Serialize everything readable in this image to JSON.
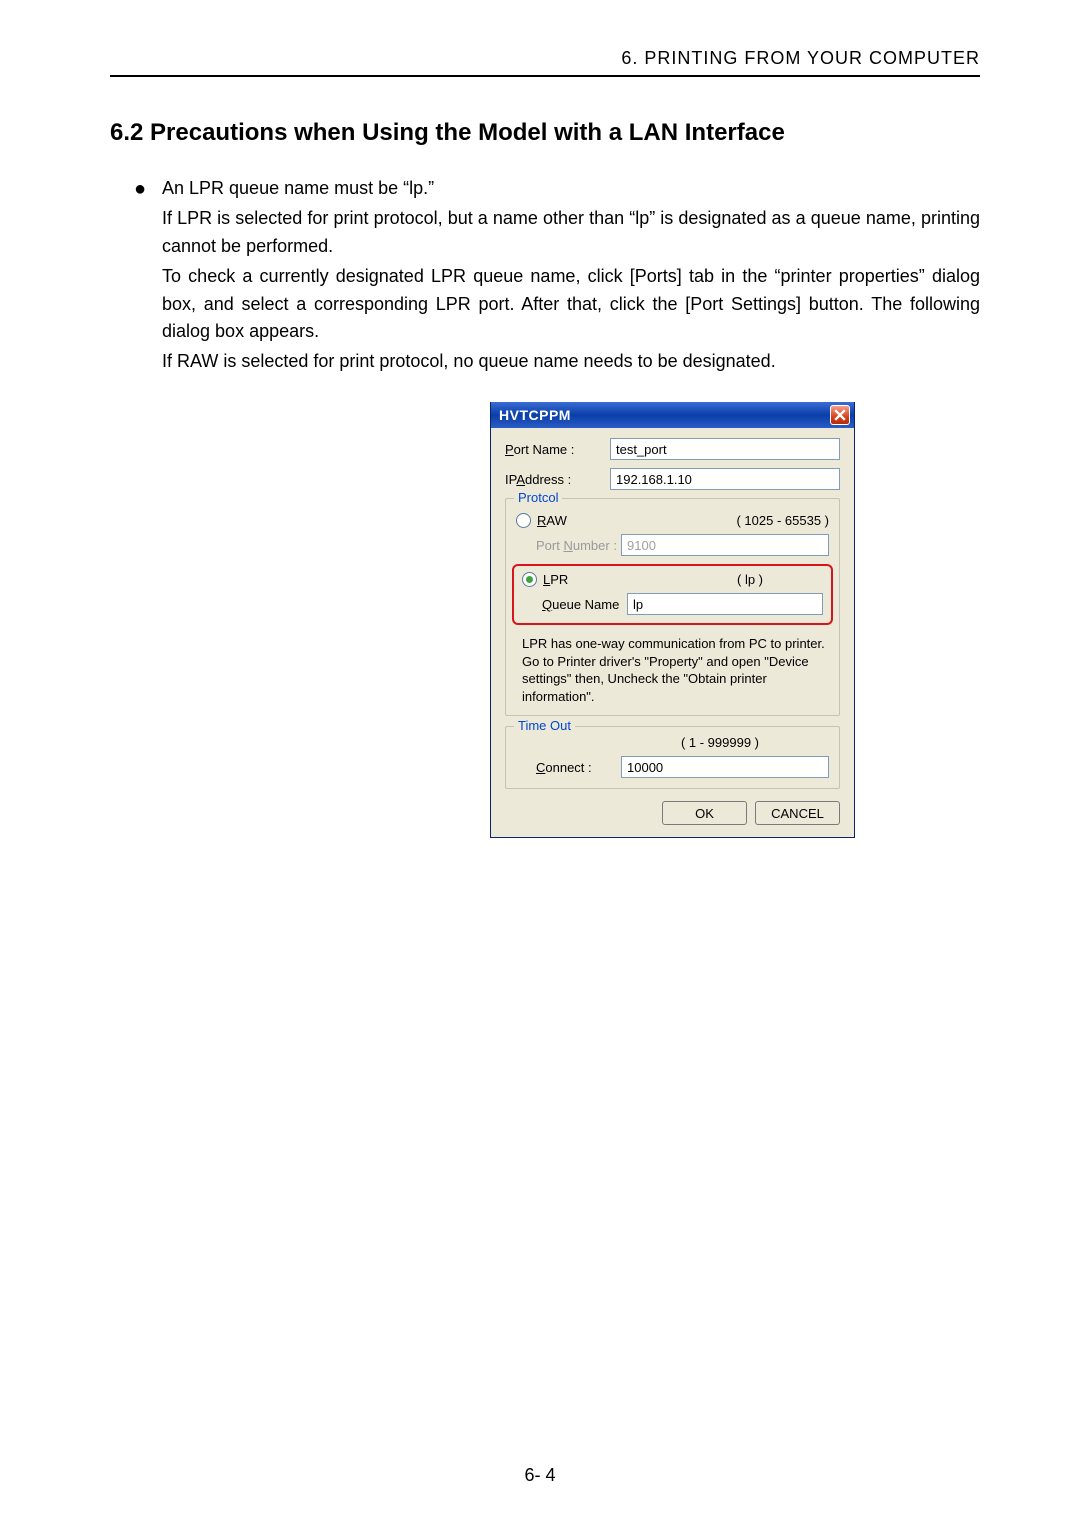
{
  "header": {
    "chapter_label": "6. PRINTING FROM YOUR COMPUTER"
  },
  "section": {
    "title": "6.2 Precautions when Using the Model with a LAN Interface"
  },
  "body": {
    "bullet": "An LPR queue name must be “lp.”",
    "p1": "If LPR is selected for print protocol, but a name other than “lp” is designated as a queue name, printing cannot be performed.",
    "p2": "To check a currently designated LPR queue name, click [Ports] tab in the “printer properties” dialog box, and select a corresponding LPR port.  After that, click the [Port Settings] button.  The following dialog box appears.",
    "p3": "If RAW is selected for print protocol, no queue name needs to be designated."
  },
  "dialog": {
    "title": "HVTCPPM",
    "port_name_label": "Port Name :",
    "port_name_value": "test_port",
    "ip_label": "IPAddress :",
    "ip_value": "192.168.1.10",
    "protocol_legend": "Protcol",
    "raw_label": "RAW",
    "raw_range": "( 1025 - 65535 )",
    "port_number_label": "Port Number :",
    "port_number_value": "9100",
    "lpr_label": "LPR",
    "lpr_hint": "( lp )",
    "queue_label": "Queue Name",
    "queue_value": "lp",
    "note": "LPR has one-way communication from PC to printer. Go to Printer driver's \"Property\" and open \"Device settings\" then, Uncheck the \"Obtain printer information\".",
    "timeout_legend": "Time Out",
    "timeout_range": "( 1 - 999999 )",
    "connect_label": "Connect :",
    "connect_value": "10000",
    "ok": "OK",
    "cancel": "CANCEL"
  },
  "footer": {
    "page": "6- 4"
  }
}
